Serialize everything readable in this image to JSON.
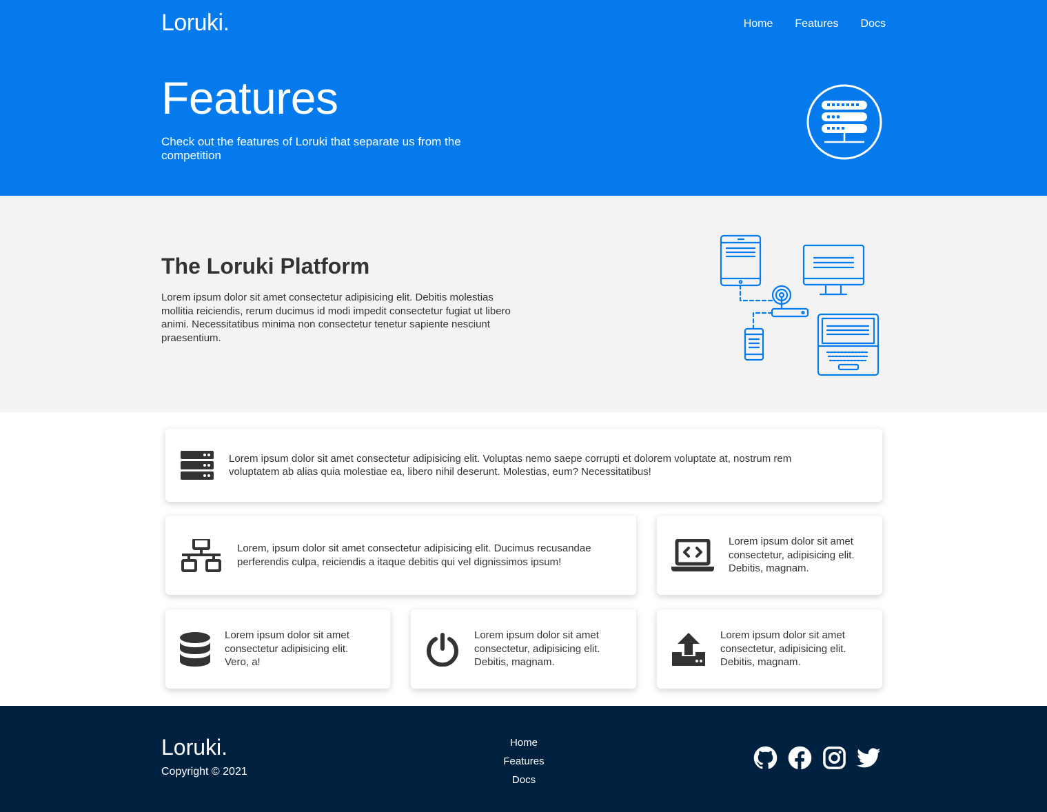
{
  "header": {
    "logo": "Loruki.",
    "nav": [
      "Home",
      "Features",
      "Docs"
    ]
  },
  "hero": {
    "title": "Features",
    "subtitle": "Check out the features of Loruki that separate us from the competition",
    "icon": "server-circle-icon"
  },
  "platform": {
    "title": "The Loruki Platform",
    "text": "Lorem ipsum dolor sit amet consectetur adipisicing elit. Debitis molestias mollitia reiciendis, rerum ducimus id modi impedit consectetur fugiat ut libero animi. Necessitatibus minima non consectetur tenetur sapiente nesciunt praesentium.",
    "illustration": "devices-network-illustration"
  },
  "features": [
    {
      "icon": "server-icon",
      "text": "Lorem ipsum dolor sit amet consectetur adipisicing elit. Voluptas nemo saepe corrupti et dolorem voluptate at, nostrum rem voluptatem ab alias quia molestiae ea, libero nihil deserunt. Molestias, eum? Necessitatibus!"
    },
    {
      "icon": "network-wired-icon",
      "text": "Lorem, ipsum dolor sit amet consectetur adipisicing elit. Ducimus recusandae perferendis culpa, reiciendis a itaque debitis qui vel dignissimos ipsum!"
    },
    {
      "icon": "laptop-code-icon",
      "text": "Lorem ipsum dolor sit amet consectetur, adipisicing elit. Debitis, magnam."
    },
    {
      "icon": "database-icon",
      "text": "Lorem ipsum dolor sit amet consectetur adipisicing elit. Vero, a!"
    },
    {
      "icon": "power-off-icon",
      "text": "Lorem ipsum dolor sit amet consectetur, adipisicing elit. Debitis, magnam."
    },
    {
      "icon": "upload-icon",
      "text": "Lorem ipsum dolor sit amet consectetur, adipisicing elit. Debitis, magnam."
    }
  ],
  "footer": {
    "logo": "Loruki.",
    "copyright": "Copyright © 2021",
    "nav": [
      "Home",
      "Features",
      "Docs"
    ],
    "social": [
      "github-icon",
      "facebook-icon",
      "instagram-icon",
      "twitter-icon"
    ]
  },
  "colors": {
    "primary": "#047aed",
    "light": "#f3f3f3",
    "dark": "#002240",
    "text": "#333333"
  }
}
